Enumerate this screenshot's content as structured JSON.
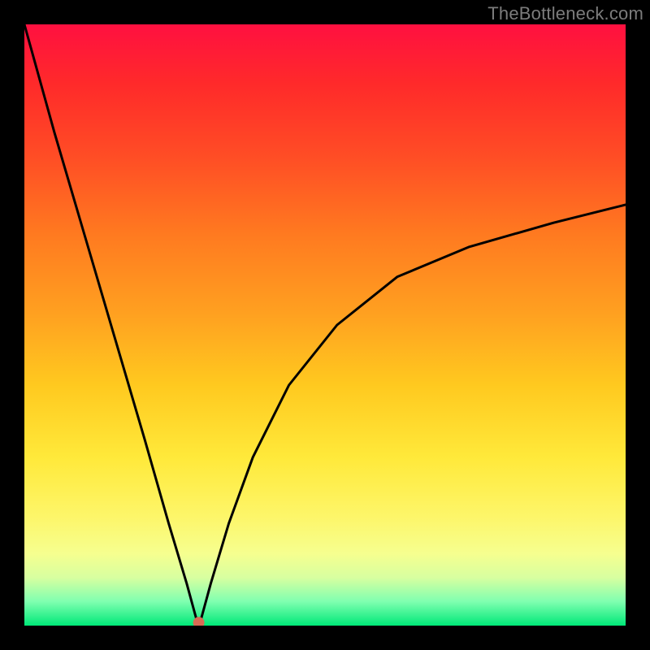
{
  "watermark": "TheBottleneck.com",
  "chart_data": {
    "type": "line",
    "title": "",
    "xlabel": "",
    "ylabel": "",
    "xlim": [
      0,
      100
    ],
    "ylim": [
      0,
      100
    ],
    "grid": false,
    "legend": false,
    "min_point": {
      "x": 29,
      "y": 0
    },
    "series": [
      {
        "name": "bottleneck-curve",
        "x": [
          0,
          5,
          10,
          15,
          20,
          24,
          27,
          28.5,
          29,
          29.5,
          31,
          34,
          38,
          44,
          52,
          62,
          74,
          88,
          100
        ],
        "y": [
          100,
          82,
          65,
          48,
          31,
          17,
          7,
          1.5,
          0,
          1.5,
          7,
          17,
          28,
          40,
          50,
          58,
          63,
          67,
          70
        ]
      }
    ],
    "marker": {
      "x": 29,
      "y": 0.5,
      "color": "#d96b55"
    },
    "gradient_stops": [
      {
        "pos": 0,
        "color": "#ff1040"
      },
      {
        "pos": 10,
        "color": "#ff2a2a"
      },
      {
        "pos": 22,
        "color": "#ff4d25"
      },
      {
        "pos": 35,
        "color": "#ff7a20"
      },
      {
        "pos": 48,
        "color": "#ffa020"
      },
      {
        "pos": 60,
        "color": "#ffc91f"
      },
      {
        "pos": 72,
        "color": "#ffe93a"
      },
      {
        "pos": 82,
        "color": "#fdf66a"
      },
      {
        "pos": 88,
        "color": "#f6ff8f"
      },
      {
        "pos": 92,
        "color": "#d8ffa0"
      },
      {
        "pos": 96,
        "color": "#7fffb0"
      },
      {
        "pos": 100,
        "color": "#00e878"
      }
    ]
  }
}
